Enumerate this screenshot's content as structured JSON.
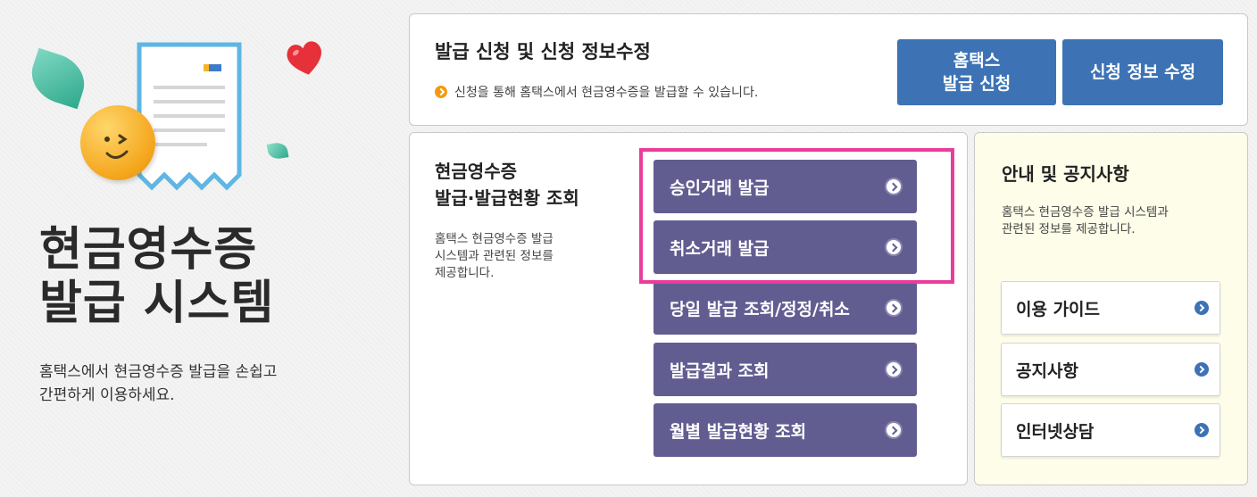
{
  "hero": {
    "title_line1": "현금영수증",
    "title_line2": "발급 시스템",
    "desc_line1": "홈택스에서 현금영수증 발급을 손쉽고",
    "desc_line2": "간편하게 이용하세요."
  },
  "top_panel": {
    "title": "발급 신청 및 신청 정보수정",
    "note": "신청을 통해 홈택스에서 현금영수증을 발급할 수 있습니다.",
    "hometax_button_line1": "홈택스",
    "hometax_button_line2": "발급 신청",
    "edit_button": "신청 정보 수정"
  },
  "mid_panel": {
    "title_line1": "현금영수증",
    "title_line2": "발급·발급현황 조회",
    "desc_line1": "홈택스 현금영수증 발급",
    "desc_line2": "시스템과 관련된 정보를",
    "desc_line3": "제공합니다.",
    "buttons": [
      {
        "label": "승인거래 발급"
      },
      {
        "label": "취소거래 발급"
      },
      {
        "label": "당일 발급 조회/정정/취소"
      },
      {
        "label": "발급결과 조회"
      },
      {
        "label": "월별 발급현황 조회"
      }
    ]
  },
  "right_panel": {
    "title": "안내 및 공지사항",
    "desc_line1": "홈택스 현금영수증 발급 시스템과",
    "desc_line2": "관련된 정보를 제공합니다.",
    "buttons": [
      {
        "label": "이용 가이드"
      },
      {
        "label": "공지사항"
      },
      {
        "label": "인터넷상담"
      }
    ]
  },
  "colors": {
    "purple_button": "#625d91",
    "blue_button": "#3d73b5",
    "highlight": "#ea3c9b",
    "orange_bullet": "#f39a12",
    "notice_panel_bg": "#fdfde9"
  }
}
